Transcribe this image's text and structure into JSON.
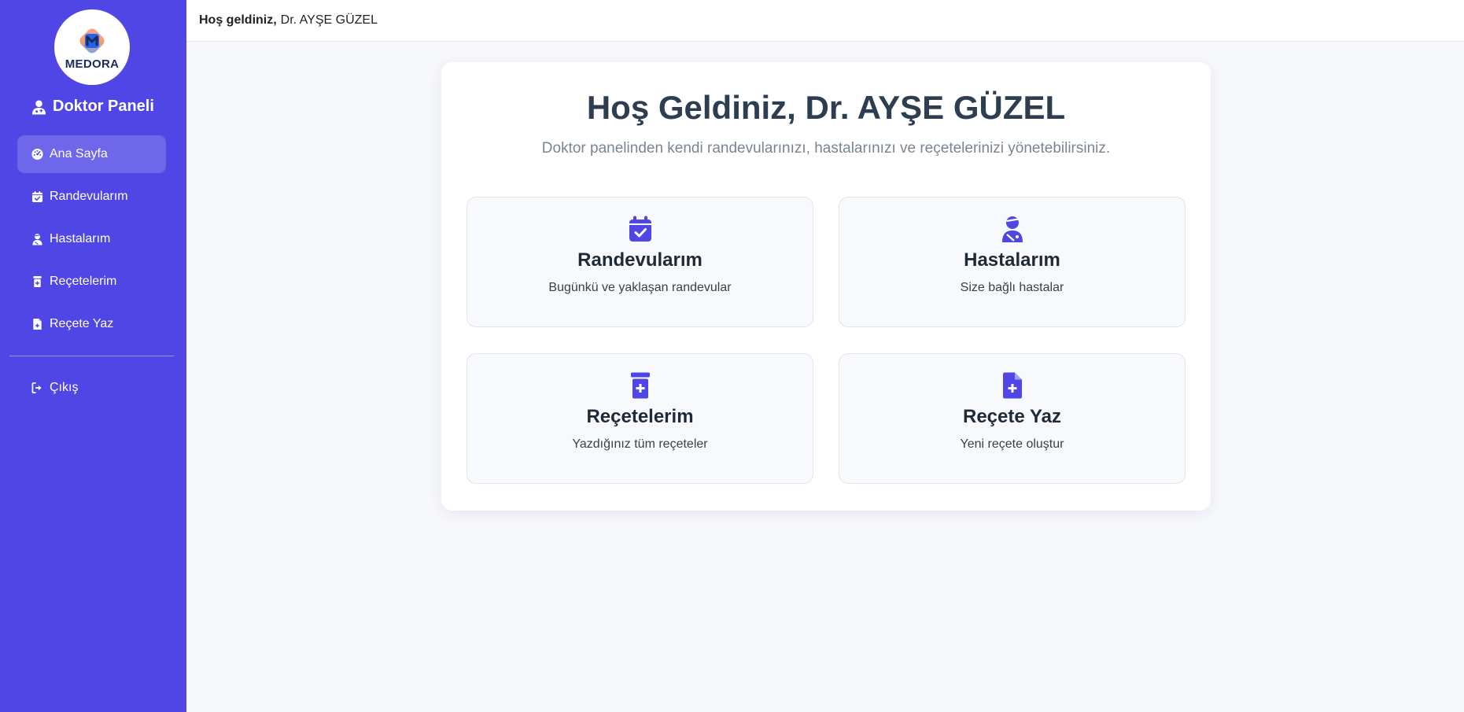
{
  "brand": {
    "logo_text": "MEDORA"
  },
  "sidebar": {
    "title": "Doktor Paneli",
    "items": [
      {
        "label": "Ana Sayfa",
        "icon": "dashboard-icon",
        "active": true
      },
      {
        "label": "Randevularım",
        "icon": "calendar-check-icon"
      },
      {
        "label": "Hastalarım",
        "icon": "user-injured-icon"
      },
      {
        "label": "Reçetelerim",
        "icon": "prescription-bottle-icon"
      },
      {
        "label": "Reçete Yaz",
        "icon": "file-medical-icon"
      }
    ],
    "logout": {
      "label": "Çıkış",
      "icon": "sign-out-icon"
    }
  },
  "header": {
    "greeting": "Hoş geldiniz,",
    "user": "Dr. AYŞE GÜZEL"
  },
  "main": {
    "title": "Hoş Geldiniz, Dr. AYŞE GÜZEL",
    "subtitle": "Doktor panelinden kendi randevularınızı, hastalarınızı ve reçetelerinizi yönetebilirsiniz.",
    "tiles": [
      {
        "title": "Randevularım",
        "desc": "Bugünkü ve yaklaşan randevular",
        "icon": "calendar-check-icon"
      },
      {
        "title": "Hastalarım",
        "desc": "Size bağlı hastalar",
        "icon": "user-injured-icon"
      },
      {
        "title": "Reçetelerim",
        "desc": "Yazdığınız tüm reçeteler",
        "icon": "prescription-bottle-icon"
      },
      {
        "title": "Reçete Yaz",
        "desc": "Yeni reçete oluştur",
        "icon": "file-medical-icon"
      }
    ]
  },
  "colors": {
    "sidebar_bg": "#4f46e5",
    "accent": "#4f46e5",
    "page_bg": "#f7f8fc"
  }
}
